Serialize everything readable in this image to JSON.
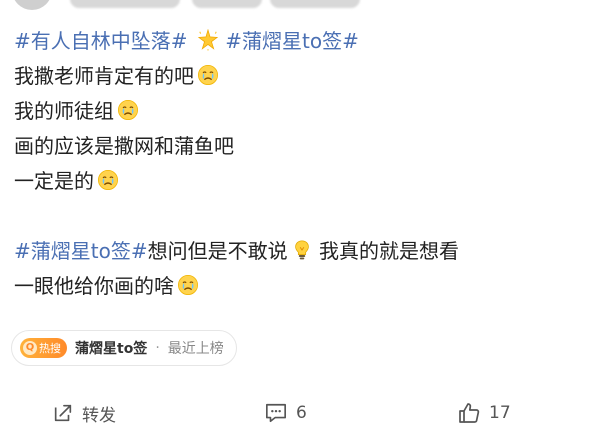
{
  "post": {
    "lines": [
      {
        "segments": [
          {
            "text": "#有人自林中坠落#",
            "type": "tag"
          },
          {
            "text": " ",
            "type": "plain"
          }
        ],
        "emoji": "sparkle-star-icon",
        "tail_segments": [
          {
            "text": " #蒲熠星to签#",
            "type": "tag"
          }
        ]
      },
      {
        "text": "我撒老师肯定有的吧",
        "emoji": "crying-face-icon"
      },
      {
        "text": "我的师徒组",
        "emoji": "crying-face-icon"
      },
      {
        "text": "画的应该是撒网和蒲鱼吧"
      },
      {
        "text": "一定是的",
        "emoji": "crying-face-icon"
      },
      {
        "blank": true
      },
      {
        "segments": [
          {
            "text": "#蒲熠星to签#",
            "type": "tag"
          },
          {
            "text": "想问但是不敢说",
            "type": "plain"
          }
        ],
        "emoji": "lightbulb-icon",
        "tail_segments": [
          {
            "text": " 我真的就是想看",
            "type": "plain"
          }
        ]
      },
      {
        "text": "一眼他给你画的啥",
        "emoji": "crying-face-icon"
      }
    ]
  },
  "hot": {
    "badge_label": "热搜",
    "badge_icon": "Q",
    "topic": "蒲熠星to签",
    "separator": "·",
    "status": "最近上榜"
  },
  "actions": {
    "repost_label": "转发",
    "comment_count": "6",
    "like_count": "17"
  },
  "colors": {
    "tag": "#4a6fb3",
    "text": "#222222",
    "hot_badge": "#ff8a2a",
    "action": "#555555"
  }
}
